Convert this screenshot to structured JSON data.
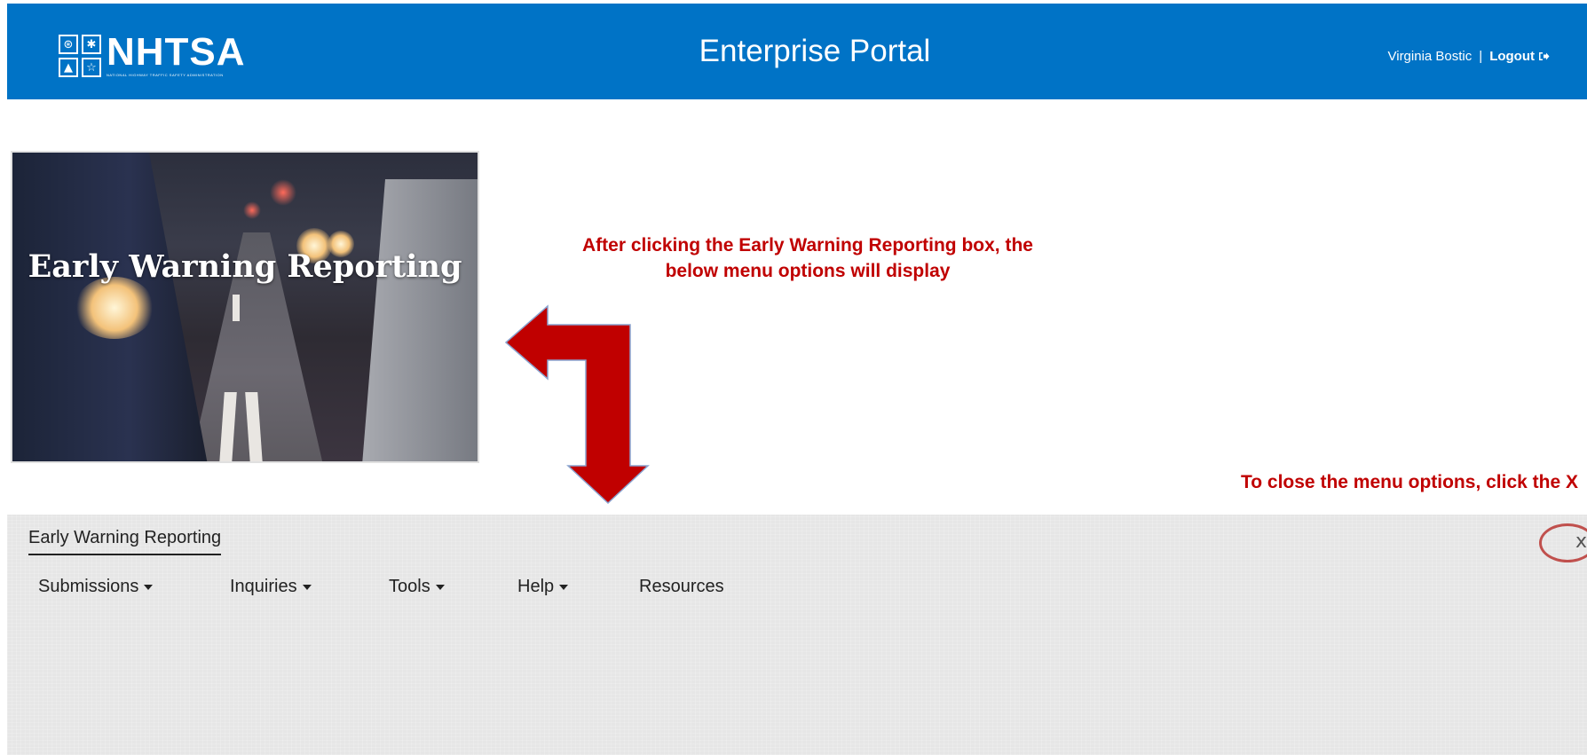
{
  "header": {
    "logo_text": "NHTSA",
    "logo_subtext": "NATIONAL HIGHWAY TRAFFIC SAFETY ADMINISTRATION",
    "title": "Enterprise Portal",
    "user_name": "Virginia Bostic",
    "separator": "|",
    "logout_label": "Logout",
    "brand_color": "#0073c6"
  },
  "tile": {
    "title": "Early Warning Reporting"
  },
  "annotations": {
    "top_line1": "After clicking the Early Warning Reporting box, the",
    "top_line2": "below menu options will display",
    "right": "To close the menu options, click the X",
    "color": "#c00000"
  },
  "menu": {
    "tab_label": "Early Warning Reporting",
    "items": [
      {
        "label": "Submissions",
        "has_dropdown": true
      },
      {
        "label": "Inquiries",
        "has_dropdown": true
      },
      {
        "label": "Tools",
        "has_dropdown": true
      },
      {
        "label": "Help",
        "has_dropdown": true
      },
      {
        "label": "Resources",
        "has_dropdown": false
      }
    ],
    "close_label": "x"
  },
  "icons": {
    "logo": "nhtsa-logo-icon",
    "logout": "logout-icon",
    "caret": "caret-down-icon",
    "close": "close-icon",
    "arrow": "arrow-icon"
  }
}
